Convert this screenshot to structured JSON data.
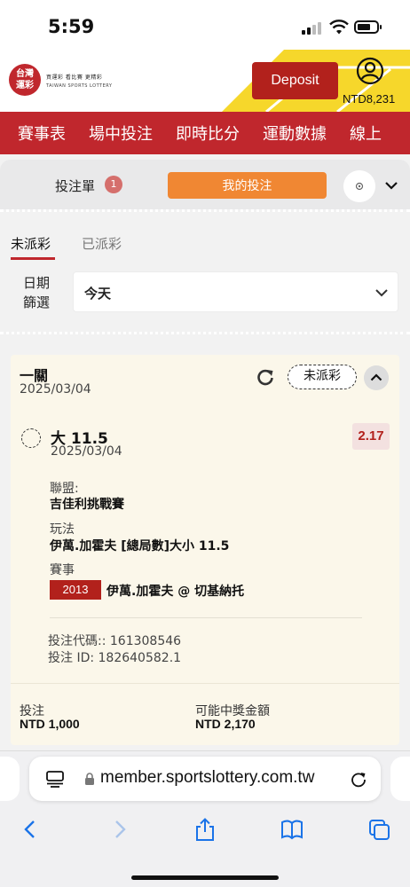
{
  "status_bar": {
    "time": "5:59"
  },
  "header": {
    "logo_text": "台灣運彩",
    "logo_line1": "買運彩 看比賽 更精彩",
    "logo_line2": "TAIWAN SPORTS LOTTERY",
    "deposit_label": "Deposit",
    "balance": "NTD8,231",
    "brand_yellow": "#f6d72b",
    "brand_red": "#c0272d"
  },
  "nav": {
    "items": [
      "賽事表",
      "場中投注",
      "即時比分",
      "運動數據",
      "線上"
    ]
  },
  "slip": {
    "label": "投注單",
    "count": "1",
    "my_bets_label": "我的投注"
  },
  "tabs": {
    "active": "未派彩",
    "inactive": "已派彩"
  },
  "filter": {
    "label": "日期篩選",
    "value": "今天"
  },
  "bet": {
    "type": "一關",
    "date": "2025/03/04",
    "status": "未派彩",
    "selection": "大 11.5",
    "selection_date": "2025/03/04",
    "odds": "2.17",
    "league_label": "聯盟:",
    "league": "吉佳利挑戰賽",
    "market_label": "玩法",
    "market": "伊萬.加霍夫 [總局數]大小 11.5",
    "event_label": "賽事",
    "event_code": "2013",
    "event": "伊萬.加霍夫 @ 切基納托",
    "bet_code": "投注代碼:: 161308546",
    "bet_id": "投注 ID: 182640582.1",
    "stake_label": "投注",
    "stake": "NTD 1,000",
    "payout_label": "可能中獎金額",
    "payout": "NTD 2,170"
  },
  "browser": {
    "url": "member.sportslottery.com.tw"
  }
}
